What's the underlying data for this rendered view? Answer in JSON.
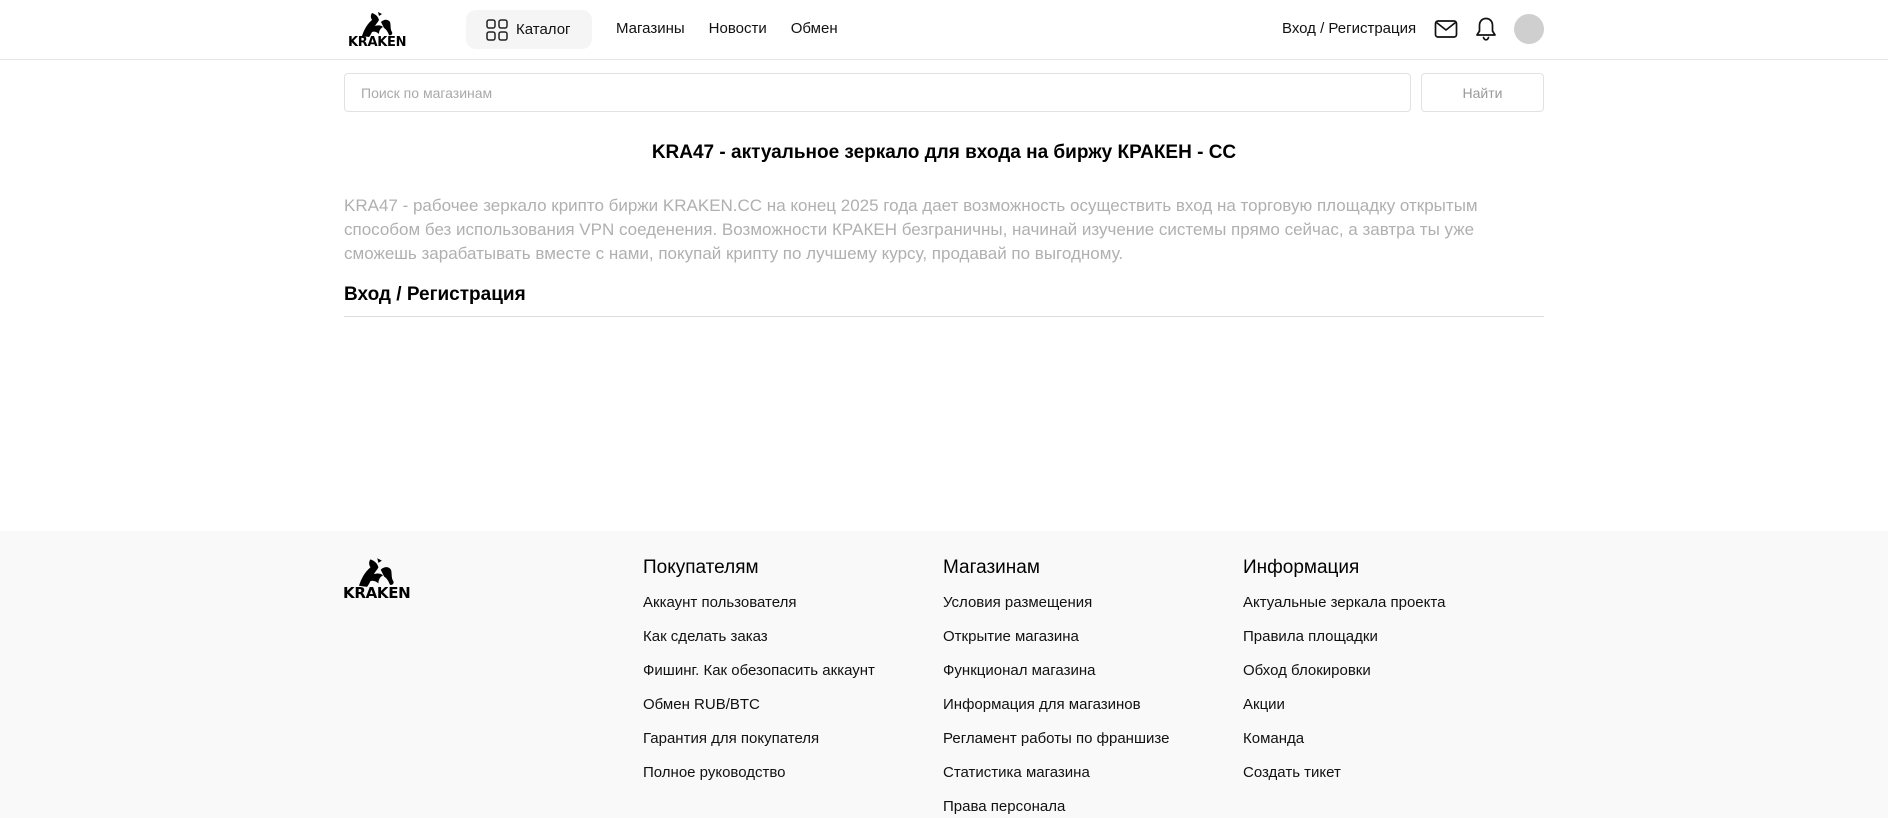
{
  "header": {
    "logo_text": "KRAKEN",
    "catalog_label": "Каталог",
    "nav": [
      "Магазины",
      "Новости",
      "Обмен"
    ],
    "login_label": "Вход / Регистрация"
  },
  "search": {
    "placeholder": "Поиск по магазинам",
    "button_label": "Найти"
  },
  "main": {
    "title": "KRA47 - актуальное зеркало для входа на биржу КРАКЕН - CC",
    "description": "KRA47 - рабочее зеркало крипто биржи KRAKEN.CC на конец 2025 года дает возможность осуществить вход на торговую площадку открытым способом без использования VPN соеденения. Возможности КРАКЕН безграничны, начинай изучение системы прямо сейчас, а завтра ты уже сможешь зарабатывать вместе с нами, покупай крипту по лучшему курсу, продавай по выгодному.",
    "section_heading": "Вход / Регистрация"
  },
  "footer": {
    "logo_text": "KRAKEN",
    "columns": [
      {
        "title": "Покупателям",
        "links": [
          "Аккаунт пользователя",
          "Как сделать заказ",
          "Фишинг. Как обезопасить аккаунт",
          "Обмен RUB/BTC",
          "Гарантия для покупателя",
          "Полное руководство"
        ]
      },
      {
        "title": "Магазинам",
        "links": [
          "Условия размещения",
          "Открытие магазина",
          "Функционал магазина",
          "Информация для магазинов",
          "Регламент работы по франшизе",
          "Статистика магазина",
          "Права персонала"
        ]
      },
      {
        "title": "Информация",
        "links": [
          "Актуальные зеркала проекта",
          "Правила площадки",
          "Обход блокировки",
          "Акции",
          "Команда",
          "Создать тикет"
        ]
      }
    ]
  },
  "icons": {
    "logo": "kraken-octopus-logo-icon",
    "catalog": "grid-icon",
    "mail": "mail-icon",
    "notifications": "bell-icon"
  },
  "colors": {
    "accent_bg": "#f5f5f5",
    "footer_bg": "#f9f9f9",
    "description_text": "#b0b0b0"
  }
}
